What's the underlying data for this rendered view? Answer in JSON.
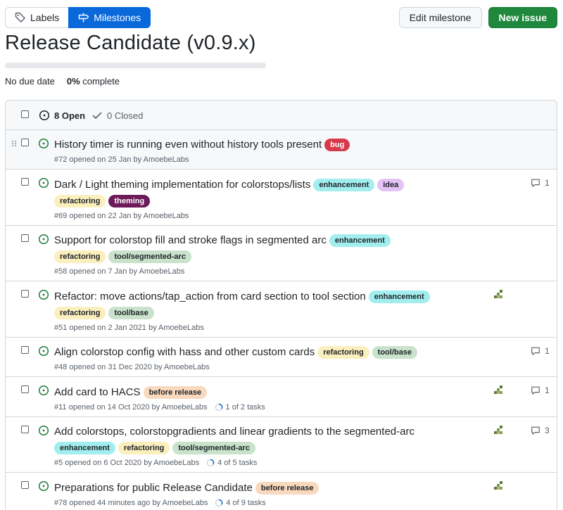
{
  "tabs": {
    "labels": "Labels",
    "milestones": "Milestones"
  },
  "actions": {
    "edit": "Edit milestone",
    "new_issue": "New issue"
  },
  "milestone": {
    "title": "Release Candidate (v0.9.x)",
    "due": "No due date",
    "percent": "0%",
    "percent_suffix": "complete",
    "progress": 0
  },
  "header": {
    "open": "8 Open",
    "closed": "0 Closed"
  },
  "colors": {
    "primary": "#0969da",
    "success": "#1f883d",
    "open_icon": "#1a7f37"
  },
  "issues": [
    {
      "title": "History timer is running even without history tools present",
      "labels": [
        {
          "name": "bug",
          "bg": "#d73a4a",
          "fg": "#ffffff"
        }
      ],
      "meta": "#72 opened on 25 Jan by AmoebeLabs",
      "comments": "",
      "avatar": false,
      "tasks": ""
    },
    {
      "title": "Dark / Light theming implementation for colorstops/lists",
      "labels": [
        {
          "name": "enhancement",
          "bg": "#a2eeef",
          "fg": "#1f2328"
        },
        {
          "name": "idea",
          "bg": "#e3c2f5",
          "fg": "#1f2328"
        },
        {
          "name": "refactoring",
          "bg": "#fbefbe",
          "fg": "#1f2328"
        },
        {
          "name": "theming",
          "bg": "#6c1a5a",
          "fg": "#ffffff"
        }
      ],
      "meta": "#69 opened on 22 Jan by AmoebeLabs",
      "comments": "1",
      "avatar": false,
      "tasks": ""
    },
    {
      "title": "Support for colorstop fill and stroke flags in segmented arc",
      "labels": [
        {
          "name": "enhancement",
          "bg": "#a2eeef",
          "fg": "#1f2328"
        },
        {
          "name": "refactoring",
          "bg": "#fbefbe",
          "fg": "#1f2328"
        },
        {
          "name": "tool/segmented-arc",
          "bg": "#c8e2cb",
          "fg": "#1f2328"
        }
      ],
      "meta": "#58 opened on 7 Jan by AmoebeLabs",
      "comments": "",
      "avatar": false,
      "tasks": ""
    },
    {
      "title": "Refactor: move actions/tap_action from card section to tool section",
      "labels": [
        {
          "name": "enhancement",
          "bg": "#a2eeef",
          "fg": "#1f2328"
        },
        {
          "name": "refactoring",
          "bg": "#fbefbe",
          "fg": "#1f2328"
        },
        {
          "name": "tool/base",
          "bg": "#c8e2cb",
          "fg": "#1f2328"
        }
      ],
      "meta": "#51 opened on 2 Jan 2021 by AmoebeLabs",
      "comments": "",
      "avatar": true,
      "tasks": ""
    },
    {
      "title": "Align colorstop config with hass and other custom cards",
      "labels": [
        {
          "name": "refactoring",
          "bg": "#fbefbe",
          "fg": "#1f2328"
        },
        {
          "name": "tool/base",
          "bg": "#c8e2cb",
          "fg": "#1f2328"
        }
      ],
      "meta": "#48 opened on 31 Dec 2020 by AmoebeLabs",
      "comments": "1",
      "avatar": false,
      "tasks": ""
    },
    {
      "title": "Add card to HACS",
      "labels": [
        {
          "name": "before release",
          "bg": "#f9d9bd",
          "fg": "#1f2328"
        }
      ],
      "meta": "#11 opened on 14 Oct 2020 by AmoebeLabs",
      "comments": "1",
      "avatar": true,
      "tasks": "1 of 2 tasks"
    },
    {
      "title": "Add colorstops, colorstopgradients and linear gradients to the segmented-arc",
      "labels": [
        {
          "name": "enhancement",
          "bg": "#a2eeef",
          "fg": "#1f2328"
        },
        {
          "name": "refactoring",
          "bg": "#fbefbe",
          "fg": "#1f2328"
        },
        {
          "name": "tool/segmented-arc",
          "bg": "#c8e2cb",
          "fg": "#1f2328"
        }
      ],
      "meta": "#5 opened on 6 Oct 2020 by AmoebeLabs",
      "comments": "3",
      "avatar": true,
      "tasks": "4 of 5 tasks"
    },
    {
      "title": "Preparations for public Release Candidate",
      "labels": [
        {
          "name": "before release",
          "bg": "#f9d9bd",
          "fg": "#1f2328"
        }
      ],
      "meta": "#78 opened 44 minutes ago by AmoebeLabs",
      "comments": "",
      "avatar": true,
      "tasks": "4 of 9 tasks"
    }
  ]
}
